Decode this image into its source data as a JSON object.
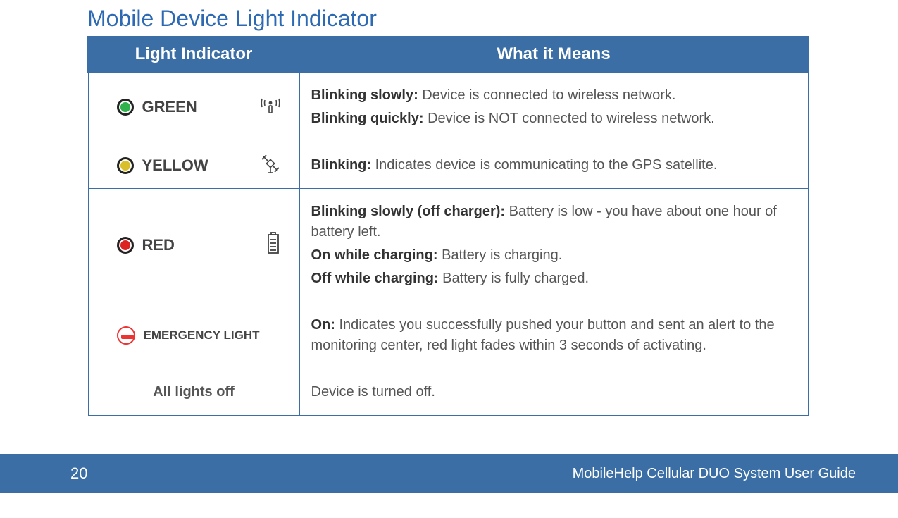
{
  "title": "Mobile Device Light Indicator",
  "columns": {
    "indicator": "Light Indicator",
    "meaning": "What it Means"
  },
  "rows": {
    "green": {
      "label": "GREEN",
      "icon": "signal-icon",
      "items": [
        {
          "bold": "Blinking slowly:",
          "text": " Device is connected to wireless network."
        },
        {
          "bold": "Blinking quickly:",
          "text": " Device is NOT connected to wireless network."
        }
      ]
    },
    "yellow": {
      "label": "YELLOW",
      "icon": "satellite-icon",
      "items": [
        {
          "bold": "Blinking:",
          "text": " Indicates device is communicating to the GPS satellite."
        }
      ]
    },
    "red": {
      "label": "RED",
      "icon": "battery-icon",
      "items": [
        {
          "bold": "Blinking slowly (off charger):",
          "text": " Battery is low - you have about one hour of battery left."
        },
        {
          "bold": "On while charging:",
          "text": " Battery is charging."
        },
        {
          "bold": "Off while charging:",
          "text": " Battery is fully charged."
        }
      ]
    },
    "emergency": {
      "label": "EMERGENCY LIGHT",
      "items": [
        {
          "bold": "On:",
          "text": " Indicates you successfully pushed your button and sent an alert to the monitoring center, red light fades within 3 seconds of activating."
        }
      ]
    },
    "off": {
      "label": "All lights off",
      "text": "Device is turned off."
    }
  },
  "footer": {
    "page": "20",
    "guide": "MobileHelp Cellular DUO System User Guide"
  }
}
